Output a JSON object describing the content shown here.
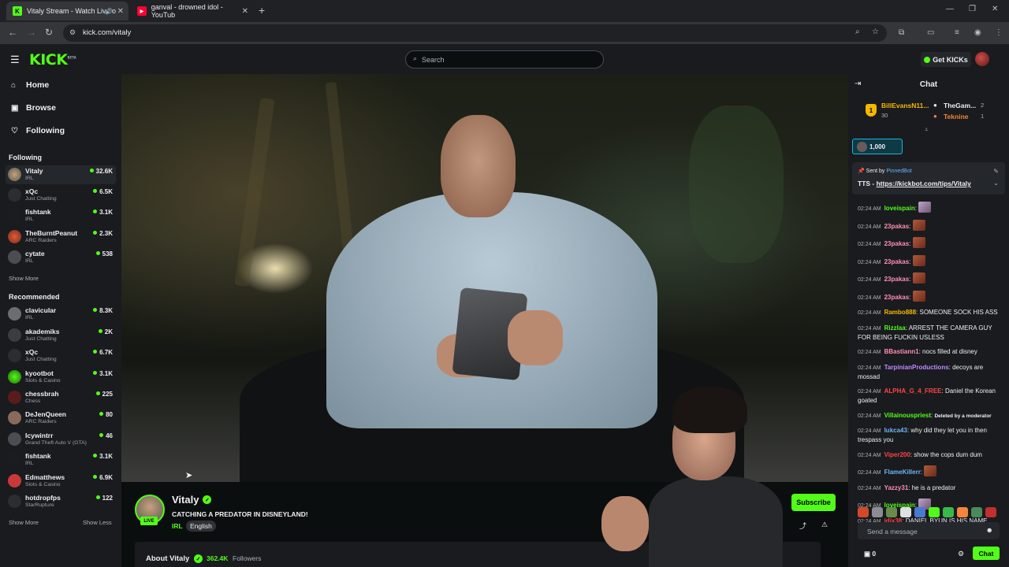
{
  "browser": {
    "tabs": [
      {
        "label": "Vitaly Stream - Watch Live o",
        "favicon": "K",
        "active": true
      },
      {
        "label": "ganval - drowned idol - YouTub",
        "favicon": "▶",
        "active": false
      }
    ],
    "url": "kick.com/vitaly"
  },
  "header": {
    "logo": "KICK",
    "logo_badge": "BETA",
    "search_placeholder": "Search",
    "get_kicks": "Get KICKs"
  },
  "sidebar": {
    "nav": [
      {
        "label": "Home",
        "icon": "home-icon"
      },
      {
        "label": "Browse",
        "icon": "browse-icon"
      },
      {
        "label": "Following",
        "icon": "heart-icon"
      }
    ],
    "following_title": "Following",
    "following": [
      {
        "name": "Vitaly",
        "category": "IRL",
        "viewers": "32.6K"
      },
      {
        "name": "xQc",
        "category": "Just Chatting",
        "viewers": "6.5K"
      },
      {
        "name": "fishtank",
        "category": "IRL",
        "viewers": "3.1K"
      },
      {
        "name": "TheBurntPeanut",
        "category": "ARC Raiders",
        "viewers": "2.3K"
      },
      {
        "name": "cytate",
        "category": "IRL",
        "viewers": "538"
      }
    ],
    "show_more_1": "Show More",
    "recommended_title": "Recommended",
    "recommended": [
      {
        "name": "clavicular",
        "category": "IRL",
        "viewers": "8.3K"
      },
      {
        "name": "akademiks",
        "category": "Just Chatting",
        "viewers": "2K"
      },
      {
        "name": "xQc",
        "category": "Just Chatting",
        "viewers": "6.7K"
      },
      {
        "name": "kyootbot",
        "category": "Slots & Casino",
        "viewers": "3.1K"
      },
      {
        "name": "chessbrah",
        "category": "Chess",
        "viewers": "225"
      },
      {
        "name": "DeJenQueen",
        "category": "ARC Raiders",
        "viewers": "80"
      },
      {
        "name": "Icywintrr",
        "category": "Grand Theft Auto V (GTA)",
        "viewers": "46"
      },
      {
        "name": "fishtank",
        "category": "IRL",
        "viewers": "3.1K"
      },
      {
        "name": "Edmatthews",
        "category": "Slots & Casino",
        "viewers": "6.9K"
      },
      {
        "name": "hotdropfps",
        "category": "StarRupture",
        "viewers": "122"
      }
    ],
    "show_more_2": "Show More",
    "show_less": "Show Less"
  },
  "stream": {
    "streamer": "Vitaly",
    "live_badge": "LIVE",
    "title": "CATCHING A PREDATOR IN DISNEYLAND!",
    "category": "IRL",
    "tag": "English",
    "subscribe": "Subscribe",
    "about_title": "About Vitaly",
    "followers_count": "362.4K",
    "followers_label": "Followers"
  },
  "chat": {
    "title": "Chat",
    "leaderboard": {
      "first_name": "BillEvansN11...",
      "first_value": "30",
      "second_name": "TheGam...",
      "second_value": "2",
      "third_name": "Teknine",
      "third_value": "1",
      "rank": "1"
    },
    "kicks_pill": "1,000",
    "pinned_sent_by": "Sent by",
    "pinned_bot": "PinnedBot",
    "pinned_prefix": "TTS - ",
    "pinned_link": "https://kickbot.com/tips/Vitaly",
    "messages": [
      {
        "time": "02:24 AM",
        "user": "loveispain",
        "color": "#53fc18",
        "text": "",
        "emote": "p"
      },
      {
        "time": "02:24 AM",
        "user": "23pakas",
        "color": "#ff8fb0",
        "text": "",
        "emote": "r"
      },
      {
        "time": "02:24 AM",
        "user": "23pakas",
        "color": "#ff8fb0",
        "text": "",
        "emote": "r"
      },
      {
        "time": "02:24 AM",
        "user": "23pakas",
        "color": "#ff8fb0",
        "text": "",
        "emote": "r"
      },
      {
        "time": "02:24 AM",
        "user": "23pakas",
        "color": "#ff8fb0",
        "text": "",
        "emote": "r"
      },
      {
        "time": "02:24 AM",
        "user": "23pakas",
        "color": "#ff8fb0",
        "text": "",
        "emote": "r"
      },
      {
        "time": "02:24 AM",
        "user": "Rambo888",
        "color": "#f5b800",
        "text": "SOMEONE SOCK HIS ASS",
        "emote": ""
      },
      {
        "time": "02:24 AM",
        "user": "Rizzlaa",
        "color": "#53fc18",
        "text": "ARREST THE CAMERA GUY FOR BEING FUCKIN USLESS",
        "emote": ""
      },
      {
        "time": "02:24 AM",
        "user": "BBastiann1",
        "color": "#ff8fb0",
        "text": "nocs filled at disney",
        "emote": ""
      },
      {
        "time": "02:24 AM",
        "user": "TarpinianProductions",
        "color": "#c08cff",
        "text": "decoys are mossad",
        "emote": ""
      },
      {
        "time": "02:24 AM",
        "user": "ALPHA_G_4_FREE",
        "color": "#ff4545",
        "text": "Daniel the Korean goated",
        "emote": ""
      },
      {
        "time": "02:24 AM",
        "user": "Villainouspriest",
        "color": "#53fc18",
        "text": "",
        "emote": "",
        "deleted": "Deleted by a moderator"
      },
      {
        "time": "02:24 AM",
        "user": "lukca43",
        "color": "#6db6f5",
        "text": "why did they let you in then trespass you",
        "emote": ""
      },
      {
        "time": "02:24 AM",
        "user": "Viper200",
        "color": "#ff4545",
        "text": "show the cops dum dum",
        "emote": ""
      },
      {
        "time": "02:24 AM",
        "user": "FlameKillerr",
        "color": "#6db6f5",
        "text": "",
        "emote": "r"
      },
      {
        "time": "02:24 AM",
        "user": "Yazzy31",
        "color": "#ff8fb0",
        "text": "he is a predator",
        "emote": ""
      },
      {
        "time": "02:24 AM",
        "user": "loveispain",
        "color": "#53fc18",
        "text": "",
        "emote": "p"
      },
      {
        "time": "02:24 AM",
        "user": "jdix38",
        "color": "#ff4545",
        "text": "DANIEL BYUN IS HIS NAME",
        "emote": ""
      }
    ],
    "input_placeholder": "Send a message",
    "kicks_count": "0",
    "send_button": "Chat"
  }
}
